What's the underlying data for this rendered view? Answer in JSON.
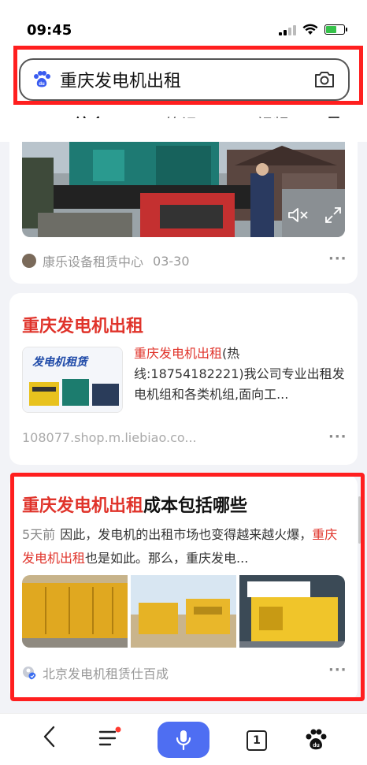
{
  "status": {
    "time": "09:45"
  },
  "search": {
    "query": "重庆发电机出租"
  },
  "tabs": [
    {
      "label": "综合"
    },
    {
      "label": "笔记"
    },
    {
      "label": "视频"
    }
  ],
  "card1": {
    "source": "康乐设备租赁中心",
    "date": "03-30",
    "more": "···"
  },
  "card2": {
    "title": "重庆发电机出租",
    "thumb_caption": "发电机租赁",
    "text_highlight": "重庆发电机出租",
    "text_rest": "(热线:18754182221)我公司专业出租发电机组和各类机组,面向工...",
    "url": "108077.shop.m.liebiao.co...",
    "more": "···"
  },
  "card3": {
    "title_highlight": "重庆发电机出租",
    "title_rest": "成本包括哪些",
    "date": "5天前",
    "text_part1": "因此，发电机的出租市场也变得越来越火爆，",
    "text_highlight": "重庆发电机出租",
    "text_part2": "也是如此。那么，重庆发电...",
    "source": "北京发电机租赁仕百成",
    "more": "···"
  },
  "bottom": {
    "tabs_count": "1"
  },
  "colors": {
    "accent": "#4e6ef2",
    "highlight": "#e0342b",
    "annotation": "#ff1f1f"
  },
  "icons": [
    "baidu-paw-icon",
    "camera-icon",
    "filter-icon",
    "mute-icon",
    "fullscreen-icon",
    "back-icon",
    "menu-icon",
    "mic-icon",
    "tabs-icon"
  ]
}
